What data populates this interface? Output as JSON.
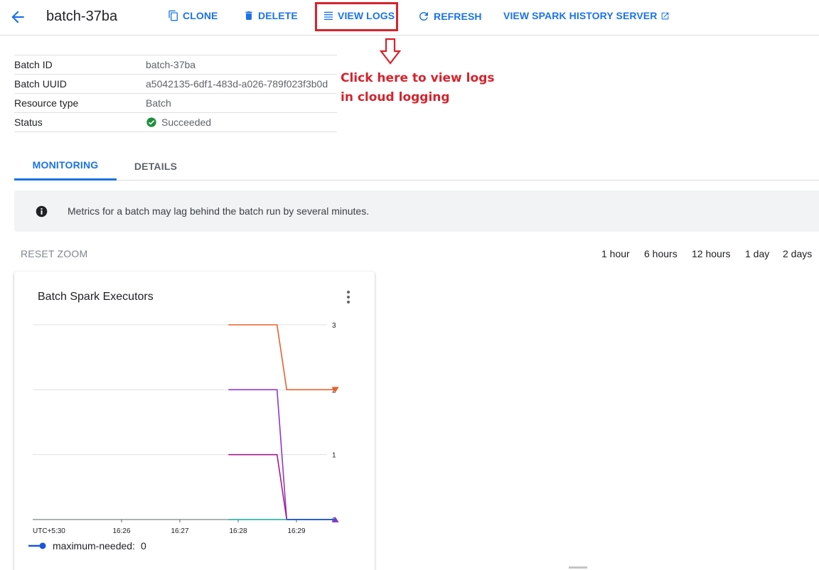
{
  "header": {
    "back_icon": "arrow-back-icon",
    "title": "batch-37ba",
    "actions": {
      "clone": "CLONE",
      "delete": "DELETE",
      "view_logs": "VIEW LOGS",
      "refresh": "REFRESH",
      "history": "VIEW SPARK HISTORY SERVER"
    },
    "accent_color": "#1a73e8"
  },
  "annotation": {
    "line1": "Click here to view logs",
    "line2": "in cloud logging",
    "color": "#d6232d"
  },
  "info": {
    "batch_id_label": "Batch ID",
    "batch_id": "batch-37ba",
    "uuid_label": "Batch UUID",
    "uuid": "a5042135-6df1-483d-a026-789f023f3b0d",
    "resource_label": "Resource type",
    "resource": "Batch",
    "status_label": "Status",
    "status": "Succeeded",
    "status_color": "#1e8e3e"
  },
  "tabs": {
    "monitoring": "MONITORING",
    "details": "DETAILS"
  },
  "banner": {
    "text": "Metrics for a batch may lag behind the batch run by several minutes."
  },
  "zoom": {
    "reset": "RESET ZOOM",
    "ranges": [
      "1 hour",
      "6 hours",
      "12 hours",
      "1 day",
      "2 days"
    ]
  },
  "card": {
    "title": "Batch Spark Executors",
    "legend": {
      "maximum_needed": "maximum-needed:",
      "maximum_needed_value": "0"
    }
  },
  "chart_data": {
    "type": "line",
    "title": "Batch Spark Executors",
    "timezone_label": "UTC+5:30",
    "x_tick_labels": [
      "16:26",
      "16:27",
      "16:28",
      "16:29"
    ],
    "y_tick_labels": [
      "0",
      "1",
      "2",
      "3"
    ],
    "ylim": [
      0,
      3
    ],
    "y_axis_position": "right",
    "grid": true,
    "series": [
      {
        "name": "series-orange",
        "color": "#e8612c",
        "x": [
          "16:27:50",
          "16:28:40",
          "16:28:50",
          "16:29:40"
        ],
        "values": [
          3,
          3,
          2,
          2
        ],
        "end_marker": "triangle-down"
      },
      {
        "name": "series-violet",
        "color": "#8c38c8",
        "x": [
          "16:27:50",
          "16:28:40",
          "16:28:50",
          "16:29:40"
        ],
        "values": [
          2,
          2,
          0,
          0
        ],
        "end_marker": "triangle-up"
      },
      {
        "name": "series-magenta",
        "color": "#a61c8c",
        "x": [
          "16:27:50",
          "16:28:40",
          "16:28:50",
          "16:29:40"
        ],
        "values": [
          1,
          1,
          0,
          0
        ]
      },
      {
        "name": "series-teal",
        "color": "#12a89c",
        "x": [
          "16:27:50",
          "16:28:40",
          "16:28:50",
          "16:29:40"
        ],
        "values": [
          0,
          0,
          0,
          0
        ]
      },
      {
        "name": "maximum-needed",
        "color": "#1a56db",
        "x": [
          "16:28:50",
          "16:29:40"
        ],
        "values": [
          0,
          0
        ]
      }
    ]
  }
}
